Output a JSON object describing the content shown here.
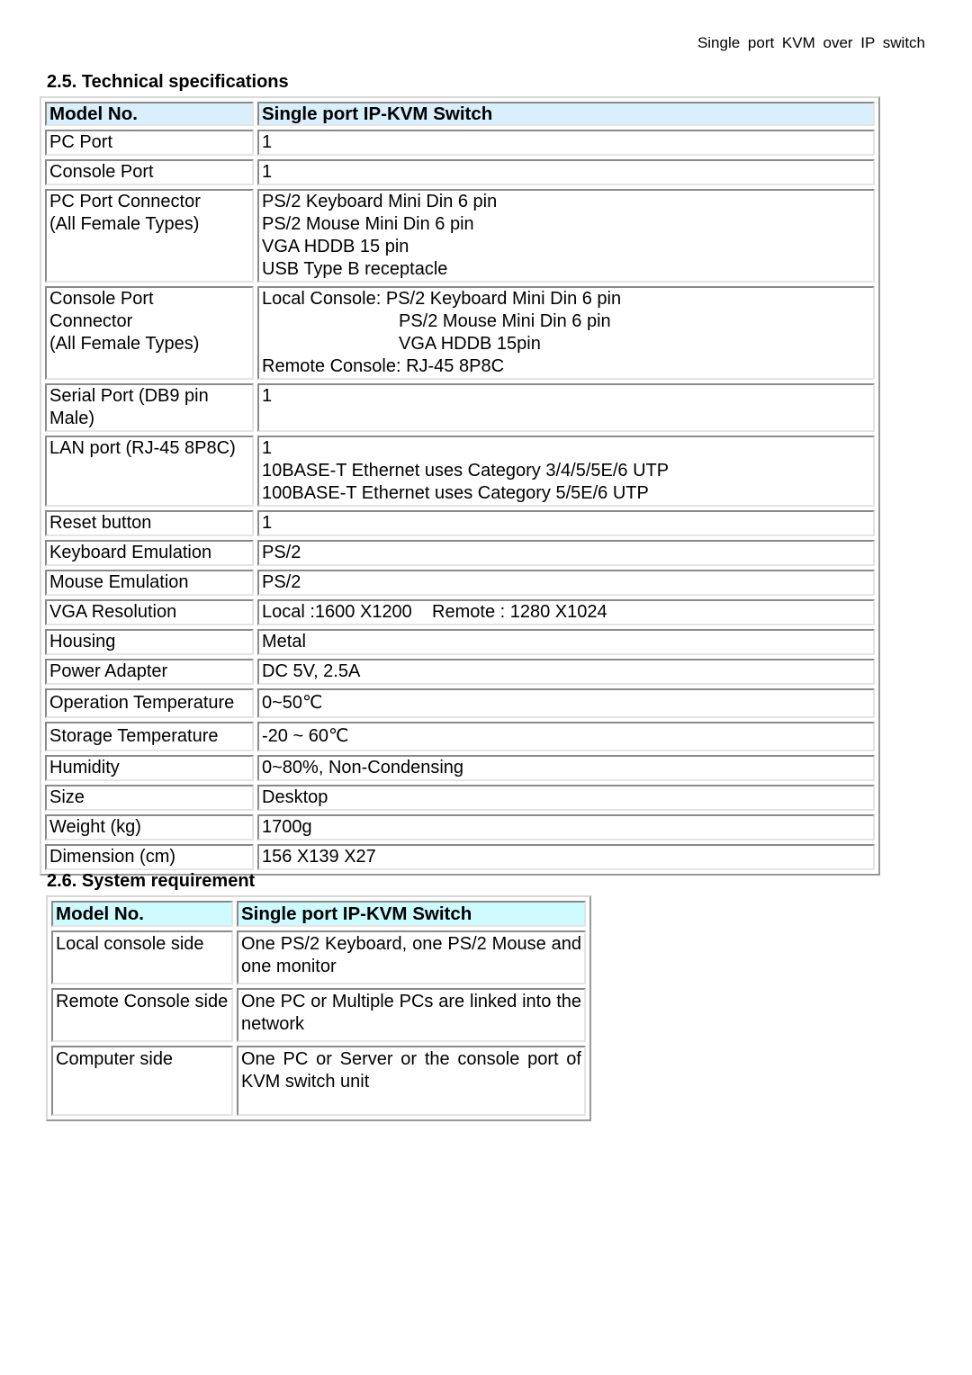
{
  "running_header": "Single port KVM over IP switch",
  "tech_specs": {
    "title": "2.5. Technical specifications",
    "header": {
      "label": "Model No.",
      "value": "Single port IP-KVM Switch"
    },
    "rows": [
      {
        "label": [
          "PC Port"
        ],
        "value": [
          "1"
        ]
      },
      {
        "label": [
          "Console Port"
        ],
        "value": [
          "1"
        ]
      },
      {
        "label": [
          "PC Port Connector",
          "(All Female Types)"
        ],
        "value": [
          "PS/2 Keyboard Mini Din 6 pin",
          "PS/2 Mouse Mini Din 6 pin",
          "VGA HDDB 15 pin",
          "USB Type B receptacle"
        ]
      },
      {
        "label": [
          "Console Port",
          "Connector",
          "(All Female Types)"
        ],
        "value": [
          "Local Console: PS/2 Keyboard Mini Din 6 pin",
          "PS/2 Mouse Mini Din 6 pin",
          "VGA HDDB 15pin",
          "Remote Console: RJ-45 8P8C"
        ]
      },
      {
        "label": [
          "Serial Port (DB9 pin",
          "Male)"
        ],
        "value": [
          "1"
        ]
      },
      {
        "label": [
          "LAN port (RJ-45 8P8C)"
        ],
        "value": [
          "1",
          "10BASE-T Ethernet uses Category 3/4/5/5E/6 UTP",
          "100BASE-T Ethernet uses Category 5/5E/6 UTP"
        ]
      },
      {
        "label": [
          "Reset button"
        ],
        "value": [
          "1"
        ]
      },
      {
        "label": [
          "Keyboard Emulation"
        ],
        "value": [
          "PS/2"
        ]
      },
      {
        "label": [
          "Mouse Emulation"
        ],
        "value": [
          "PS/2"
        ]
      },
      {
        "label": [
          "VGA Resolution"
        ],
        "value": [
          "Local :1600 X1200    Remote : 1280 X1024"
        ]
      },
      {
        "label": [
          "Housing"
        ],
        "value": [
          "Metal"
        ]
      },
      {
        "label": [
          "Power Adapter"
        ],
        "value": [
          "DC 5V, 2.5A"
        ]
      },
      {
        "label": [
          "Operation Temperature"
        ],
        "value": [
          "0~50℃"
        ]
      },
      {
        "label": [
          "Storage Temperature"
        ],
        "value": [
          "-20 ~ 60℃"
        ]
      },
      {
        "label": [
          "Humidity"
        ],
        "value": [
          "0~80%, Non-Condensing"
        ]
      },
      {
        "label": [
          "Size"
        ],
        "value": [
          "Desktop"
        ]
      },
      {
        "label": [
          "Weight (kg)"
        ],
        "value": [
          "1700g"
        ]
      },
      {
        "label": [
          "Dimension (cm)"
        ],
        "value": [
          "156 X139 X27"
        ]
      }
    ]
  },
  "system_req": {
    "title": "2.6. System requirement",
    "header": {
      "label": "Model No.",
      "value": "Single port IP-KVM Switch"
    },
    "rows": [
      {
        "label": "Local console side",
        "value": "One PS/2 Keyboard, one PS/2 Mouse and one monitor"
      },
      {
        "label": "Remote Console side",
        "value": "One PC or Multiple PCs are linked into the network"
      },
      {
        "label": "Computer side",
        "value": "One PC or Server or the console port of KVM switch unit"
      }
    ]
  },
  "colors": {
    "tech_header_bg": "#d9effc",
    "sysreq_header_bg": "#cdfbff"
  }
}
